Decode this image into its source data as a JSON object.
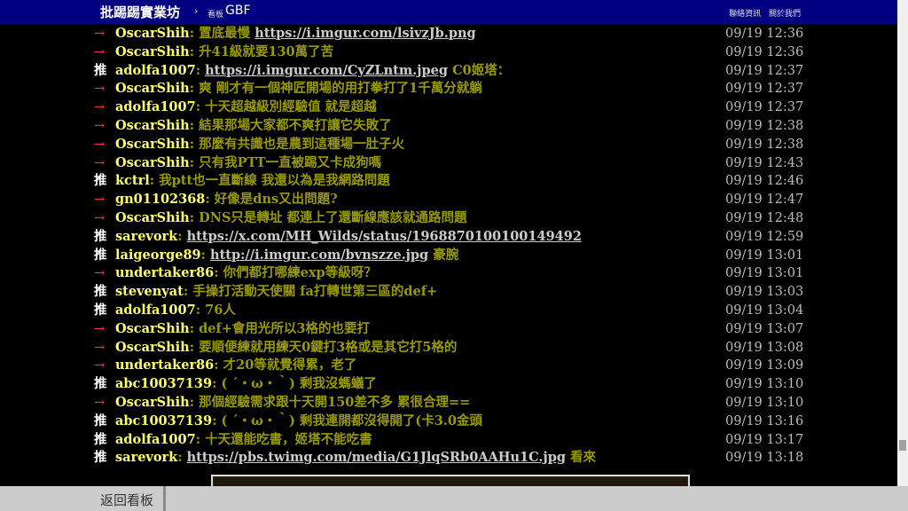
{
  "header": {
    "site_title": "批踢踢實業坊",
    "separator": "›",
    "board_label": "看板",
    "board_name": "GBF",
    "links": [
      "聯絡資訊",
      "關於我們"
    ]
  },
  "comments": [
    {
      "tag": "→",
      "user": "OscarShih",
      "pre": ": 置底最慢 ",
      "link": "https://i.imgur.com/lsivzJb.png",
      "post": "",
      "time": "09/19 12:36"
    },
    {
      "tag": "→",
      "user": "OscarShih",
      "pre": ": 升41級就要130萬了苦",
      "link": "",
      "post": "",
      "time": "09/19 12:36"
    },
    {
      "tag": "推",
      "user": "adolfa1007",
      "pre": ": ",
      "link": "https://i.imgur.com/CyZLntm.jpeg",
      "post": " C0姬塔：",
      "time": "09/19 12:37"
    },
    {
      "tag": "→",
      "user": "OscarShih",
      "pre": ": 爽 剛才有一個神匠開場的用打拳打了1千萬分就躺",
      "link": "",
      "post": "",
      "time": "09/19 12:37"
    },
    {
      "tag": "→",
      "user": "adolfa1007",
      "pre": ": 十天超越級別經驗值 就是超越",
      "link": "",
      "post": "",
      "time": "09/19 12:37"
    },
    {
      "tag": "→",
      "user": "OscarShih",
      "pre": ": 結果那場大家都不爽打讓它失敗了",
      "link": "",
      "post": "",
      "time": "09/19 12:38"
    },
    {
      "tag": "→",
      "user": "OscarShih",
      "pre": ": 那麼有共識也是農到這種場一肚子火",
      "link": "",
      "post": "",
      "time": "09/19 12:38"
    },
    {
      "tag": "→",
      "user": "OscarShih",
      "pre": ": 只有我PTT一直被踢又卡成狗嗎",
      "link": "",
      "post": "",
      "time": "09/19 12:43"
    },
    {
      "tag": "推",
      "user": "kctrl",
      "pre": ": 我ptt也一直斷線 我還以為是我網路問題",
      "link": "",
      "post": "",
      "time": "09/19 12:46"
    },
    {
      "tag": "→",
      "user": "gn01102368",
      "pre": ": 好像是dns又出問題?",
      "link": "",
      "post": "",
      "time": "09/19 12:47"
    },
    {
      "tag": "→",
      "user": "OscarShih",
      "pre": ": DNS只是轉址 都連上了還斷線應該就通路問題",
      "link": "",
      "post": "",
      "time": "09/19 12:48"
    },
    {
      "tag": "推",
      "user": "sarevork",
      "pre": ": ",
      "link": "https://x.com/MH_Wilds/status/1968870100100149492",
      "post": "",
      "time": "09/19 12:59"
    },
    {
      "tag": "推",
      "user": "laigeorge89",
      "pre": ": ",
      "link": "http://i.imgur.com/bvnszze.jpg",
      "post": " 豪腕",
      "time": "09/19 13:01"
    },
    {
      "tag": "→",
      "user": "undertaker86",
      "pre": ": 你們都打哪練exp等級呀？",
      "link": "",
      "post": "",
      "time": "09/19 13:01"
    },
    {
      "tag": "推",
      "user": "stevenyat",
      "pre": ": 手操打活動天使關 fa打轉世第三區的def+",
      "link": "",
      "post": "",
      "time": "09/19 13:03"
    },
    {
      "tag": "推",
      "user": "adolfa1007",
      "pre": ": 76人",
      "link": "",
      "post": "",
      "time": "09/19 13:04"
    },
    {
      "tag": "→",
      "user": "OscarShih",
      "pre": ": def+會用光所以3格的也要打",
      "link": "",
      "post": "",
      "time": "09/19 13:07"
    },
    {
      "tag": "→",
      "user": "OscarShih",
      "pre": ": 要順便練就用練天0鍵打3格或是其它打5格的",
      "link": "",
      "post": "",
      "time": "09/19 13:08"
    },
    {
      "tag": "→",
      "user": "undertaker86",
      "pre": ": 才20等就覺得累，老了",
      "link": "",
      "post": "",
      "time": "09/19 13:09"
    },
    {
      "tag": "推",
      "user": "abc10037139",
      "pre": ": ( ´・ω・｀) 剩我沒螞蟻了",
      "link": "",
      "post": "",
      "time": "09/19 13:10"
    },
    {
      "tag": "→",
      "user": "OscarShih",
      "pre": ": 那個經驗需求跟十天開150差不多  累很合理==",
      "link": "",
      "post": "",
      "time": "09/19 13:10"
    },
    {
      "tag": "推",
      "user": "abc10037139",
      "pre": ": ( ´・ω・｀) 剩我連開都沒得開了(卡3.0金頭",
      "link": "",
      "post": "",
      "time": "09/19 13:16"
    },
    {
      "tag": "推",
      "user": "adolfa1007",
      "pre": ": 十天還能吃書，姬塔不能吃書",
      "link": "",
      "post": "",
      "time": "09/19 13:17"
    },
    {
      "tag": "推",
      "user": "sarevork",
      "pre": ": ",
      "link": "https://pbs.twimg.com/media/G1JlqSRb0AAHu1C.jpg",
      "post": " 看來",
      "time": "09/19 13:18"
    }
  ],
  "footer": {
    "back_label": "返回看板"
  }
}
